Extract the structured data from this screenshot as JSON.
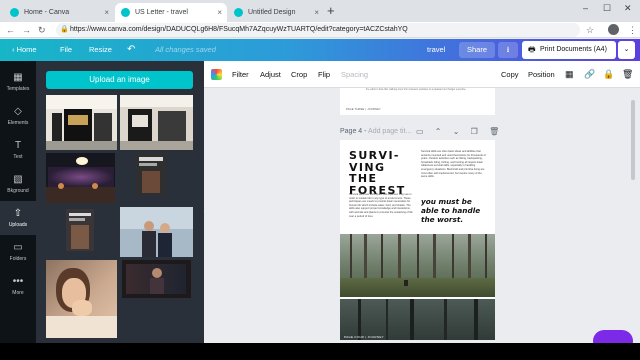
{
  "browser": {
    "tabs": [
      {
        "title": "Home - Canva",
        "favicon_color": "#00c4cc",
        "active": false
      },
      {
        "title": "US Letter - travel",
        "favicon_color": "#00c4cc",
        "active": true
      },
      {
        "title": "Untitled Design",
        "favicon_color": "#00c4cc",
        "active": false
      }
    ],
    "new_tab": "+",
    "close_glyph": "×",
    "window_controls": {
      "minimize": "–",
      "maximize": "☐",
      "close": "✕"
    },
    "url": "https://www.canva.com/design/DADUCQLg6H8/FSucqMh7AZqcuyWzTUARTQ/edit?category=tACZCstahYQ",
    "star": "☆",
    "menu": "⋮"
  },
  "header": {
    "back_label": "Home",
    "file_label": "File",
    "resize_label": "Resize",
    "undo_icon": "↶",
    "save_status": "All changes saved",
    "design_name": "travel",
    "share_label": "Share",
    "download_icon": "⭳",
    "print_label": "Print Documents (A4)",
    "print_icon": "🖶",
    "more_icon": "⌄"
  },
  "rail": {
    "items": [
      {
        "label": "Templates",
        "icon": "▦"
      },
      {
        "label": "Elements",
        "icon": "◇"
      },
      {
        "label": "Text",
        "icon": "T"
      },
      {
        "label": "Bkground",
        "icon": "▧"
      },
      {
        "label": "Uploads",
        "icon": "⇧"
      },
      {
        "label": "Folders",
        "icon": "▭"
      },
      {
        "label": "More",
        "icon": "•••"
      }
    ],
    "active": "Uploads"
  },
  "panel": {
    "upload_button": "Upload an image",
    "collapse_icon": "‹"
  },
  "toolbar": {
    "filter": "Filter",
    "adjust": "Adjust",
    "crop": "Crop",
    "flip": "Flip",
    "spacing": "Spacing",
    "copy": "Copy",
    "position": "Position",
    "transparency_icon": "▦",
    "link_icon": "🔗",
    "lock_icon": "🔒",
    "delete_icon": "🗑"
  },
  "canvas": {
    "prev_page_text": "the editor is that offer walking tours from travelers websites to a pleasant and budget expertise.",
    "prev_page_footer": "PAGE THREE | JOURNEY",
    "page_label": "Page 4 - ",
    "page_title_placeholder": "Add page tit...",
    "page_icons": [
      "▭",
      "⌃",
      "⌄",
      "❐",
      "🗑"
    ],
    "page4": {
      "title": "SURVI-\nVING THE\nFOREST",
      "left_body": "Survival skills are techniques that a person may use in order to sustain life in any type of environment. These techniques are meant to provide basic necessities for human life which include water, food, and shelter. The skills also support proper knowledge and interactions with animals and plants to promote the sustaining of life over a period of time.",
      "right_body": "Survival skills are often basic ideas and abilities that ancients invented and used themselves for thousands of years. Outdoor activities such as hiking, backpacking, horseback riding, fishing, and hunting all require basic wilderness survival skills, especially in handling emergency situations. Bushcraft and primitive living are most often self-implemented, but require many of the same skills.",
      "quote": "you must be able to handle the worst.",
      "footer": "PAGE FOUR | JOURNEY"
    }
  },
  "colors": {
    "brand_teal": "#00c4cc",
    "header_gradient_start": "#17b6c7",
    "header_gradient_end": "#5b3fe0",
    "rail_bg": "#0e1318",
    "panel_bg": "#293039",
    "help_purple": "#7d2ae8"
  }
}
